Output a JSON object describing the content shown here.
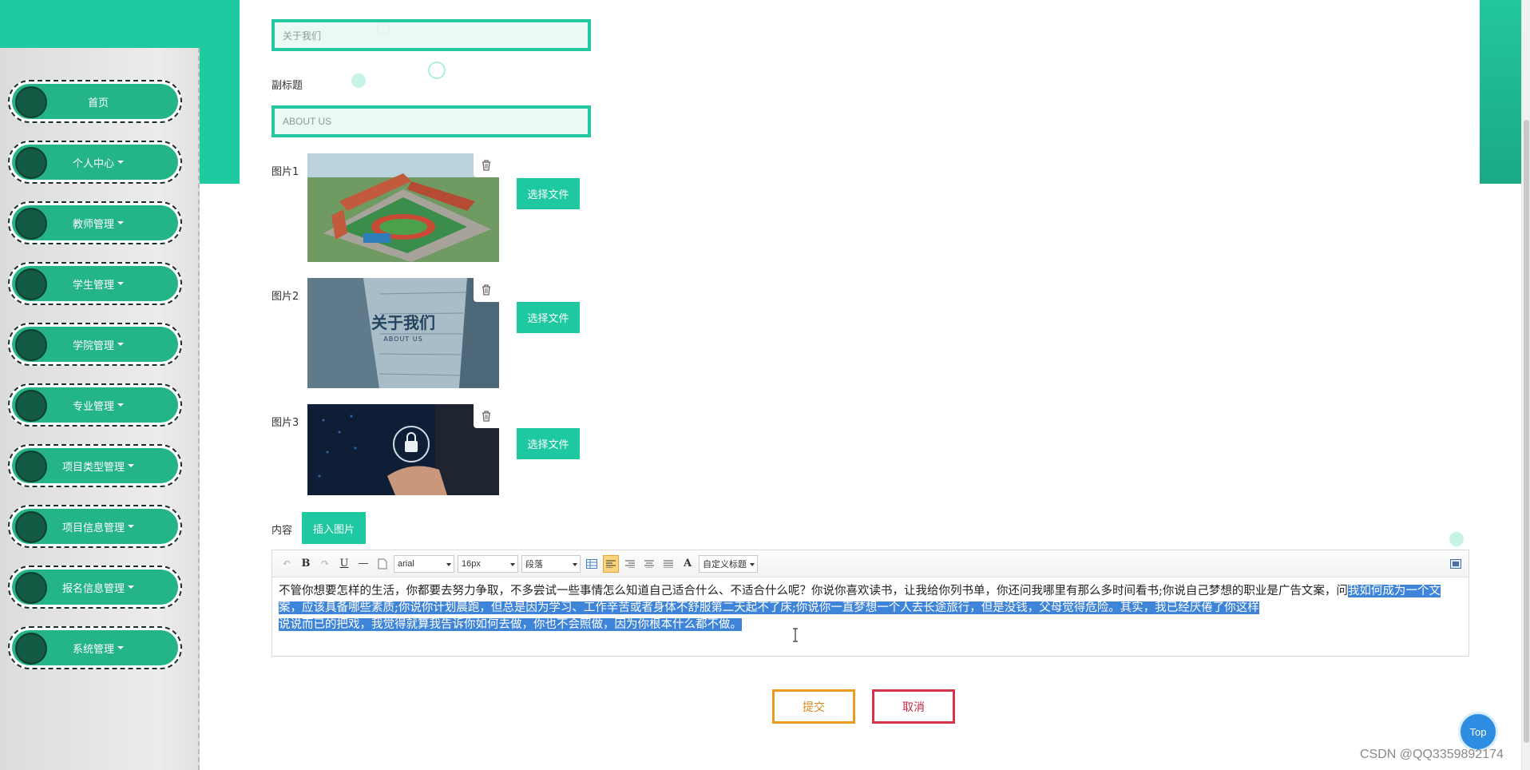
{
  "sidebar": {
    "items": [
      {
        "label": "首页",
        "has_dropdown": false
      },
      {
        "label": "个人中心",
        "has_dropdown": true
      },
      {
        "label": "教师管理",
        "has_dropdown": true
      },
      {
        "label": "学生管理",
        "has_dropdown": true
      },
      {
        "label": "学院管理",
        "has_dropdown": true
      },
      {
        "label": "专业管理",
        "has_dropdown": true
      },
      {
        "label": "项目类型管理",
        "has_dropdown": true
      },
      {
        "label": "项目信息管理",
        "has_dropdown": true
      },
      {
        "label": "报名信息管理",
        "has_dropdown": true
      },
      {
        "label": "系统管理",
        "has_dropdown": true
      }
    ]
  },
  "form": {
    "title_value": "关于我们",
    "subtitle_label": "副标题",
    "subtitle_value": "ABOUT US",
    "images": [
      {
        "label": "图片1",
        "button": "选择文件"
      },
      {
        "label": "图片2",
        "button": "选择文件",
        "overlay_title": "关于我们",
        "overlay_sub": "ABOUT US"
      },
      {
        "label": "图片3",
        "button": "选择文件"
      }
    ],
    "content_label": "内容",
    "insert_image_button": "插入图片"
  },
  "editor": {
    "font_family": "arial",
    "font_size": "16px",
    "paragraph": "段落",
    "custom_heading": "自定义标题",
    "text_plain": "不管你想要怎样的生活，你都要去努力争取，不多尝试一些事情怎么知道自己适合什么、不适合什么呢？你说你喜欢读书，让我给你列书单，你还问我哪里有那么多时间看书;你说自己梦想的职业是广告文案，问",
    "text_selected_1": "我如何成为一个文案，应该具备哪些素质;你说你计划晨跑，但总是因为学习、工作辛苦或者身体不舒服第二天起不了床;你说你一直梦想一个人去长途旅行，但是没钱，父母觉得危险。其实，我已经厌倦了你这样",
    "text_selected_2": "说说而已的把戏，我觉得就算我告诉你如何去做，你也不会照做，因为你根本什么都不做。"
  },
  "actions": {
    "submit": "提交",
    "cancel": "取消",
    "top": "Top"
  },
  "watermark": "CSDN @QQ3359892174",
  "colors": {
    "accent": "#1ec8a0",
    "submit": "#ee9a1f",
    "cancel": "#d6334c",
    "selection": "#3e84d8"
  }
}
